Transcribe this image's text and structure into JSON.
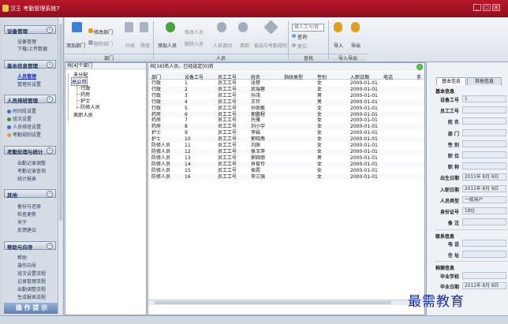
{
  "window": {
    "title": "汉王 考勤管理系统7",
    "min": "_",
    "max": "□",
    "close": "x"
  },
  "sidebar": {
    "groups": [
      {
        "label": "设备管理",
        "toggle": "«",
        "items": [
          "设备管理",
          "下载/上传数据"
        ]
      },
      {
        "label": "基本信息管理",
        "toggle": "«",
        "items": [
          "人员管理",
          "管理员设置"
        ]
      },
      {
        "label": "人员排班管理",
        "toggle": "«",
        "items": [
          "时间段设置",
          "班次设置",
          "人员排班设置",
          "考勤规则设置"
        ]
      },
      {
        "label": "考勤处理与统计",
        "toggle": "«",
        "items": [
          "出勤记录调整",
          "考勤记录查询",
          "统计报表"
        ]
      },
      {
        "label": "其他",
        "toggle": "«",
        "items": [
          "备份与还原",
          "检查更新",
          "关于",
          "反馈建议"
        ]
      },
      {
        "label": "帮助与向导",
        "toggle": "«",
        "items": [
          "帮助",
          "操作向导",
          "班次设置流程",
          "记录管理流程",
          "出勤调整流程",
          "生成报表流程"
        ]
      }
    ],
    "selected": "人员管理",
    "ops_tip": "操 作 提 示",
    "dot_colors": [
      "#3a6fd0",
      "#2e9a3c",
      "#3a6fd0",
      "#e0a020"
    ]
  },
  "ribbon": {
    "dept_buttons": {
      "add": "添加部门",
      "modify": "修改部门",
      "delete": "删除部门",
      "up": "升级",
      "down": "降级"
    },
    "person_buttons": {
      "add": "添加人员",
      "modify": "修改人员",
      "delete": "删除人员",
      "transfer": "人员调动",
      "leave": "离职",
      "batch": "被选与考勤规则"
    },
    "search": {
      "placeholder": "输入工号/姓",
      "query": "查询",
      "clear": "复位"
    },
    "io_buttons": {
      "import": "导入",
      "export": "导出"
    },
    "groups": {
      "dept": "部门",
      "person": "人员",
      "search": "查找",
      "io": "导入导出"
    }
  },
  "tree": {
    "title": "共[4]个部门",
    "nodes": [
      "未分配",
      "总公司",
      "行政",
      "药房",
      "护士",
      "防修人员",
      "离职人员"
    ]
  },
  "grid": {
    "info": "共[16]名人员，已经选定[0]名",
    "columns": [
      "部门",
      "设备工号",
      "员工工号",
      "姓名",
      "指纹类型",
      "性别",
      "入职日期",
      "电话",
      "手"
    ],
    "rows": [
      [
        "行政",
        "1",
        "员工工号",
        "张楚",
        "",
        "女",
        "2000-01-01"
      ],
      [
        "行政",
        "2",
        "员工工号",
        "武瑞蓉",
        "",
        "女",
        "2000-01-01"
      ],
      [
        "行政",
        "3",
        "员工工号",
        "孙茂",
        "",
        "男",
        "2000-01-01"
      ],
      [
        "行政",
        "4",
        "员工工号",
        "王玲",
        "",
        "男",
        "2000-01-01"
      ],
      [
        "行政",
        "5",
        "员工工号",
        "孙凯敏",
        "",
        "女",
        "2000-01-01"
      ],
      [
        "药房",
        "6",
        "员工工号",
        "郭鹏程",
        "",
        "女",
        "2000-01-01"
      ],
      [
        "药房",
        "7",
        "员工工号",
        "托雅",
        "",
        "女",
        "2000-01-01"
      ],
      [
        "药房",
        "8",
        "员工工号",
        "刘小宇",
        "",
        "女",
        "2000-01-01"
      ],
      [
        "护士",
        "9",
        "员工工号",
        "李娟",
        "",
        "女",
        "2000-01-01"
      ],
      [
        "护士",
        "10",
        "员工工号",
        "郭晓燕",
        "",
        "女",
        "2000-01-01"
      ],
      [
        "防修人员",
        "11",
        "员工工号",
        "刘辰",
        "",
        "女",
        "2000-01-01"
      ],
      [
        "防修人员",
        "12",
        "员工工号",
        "侯玉萍",
        "",
        "女",
        "2000-01-01"
      ],
      [
        "防修人员",
        "13",
        "员工工号",
        "郭婉丽",
        "",
        "男",
        "2000-01-01"
      ],
      [
        "防修人员",
        "14",
        "员工工号",
        "肖俊玲",
        "",
        "女",
        "2000-01-01"
      ],
      [
        "防修人员",
        "15",
        "员工工号",
        "侯霞",
        "",
        "女",
        "2000-01-01"
      ],
      [
        "防修人员",
        "16",
        "员工工号",
        "李三强",
        "",
        "女",
        "2000-01-01"
      ]
    ]
  },
  "detail": {
    "tabs": [
      "基本信息",
      "其他信息"
    ],
    "basic_header": "基本信息",
    "fields": [
      {
        "label": "设备工号",
        "value": "1"
      },
      {
        "label": "员工工号",
        "value": ""
      },
      {
        "label": "姓  名",
        "value": ""
      },
      {
        "label": "部  门",
        "value": ""
      },
      {
        "label": "性  别",
        "value": ""
      },
      {
        "label": "职  位",
        "value": ""
      },
      {
        "label": "职  称",
        "value": ""
      },
      {
        "label": "出生日期",
        "value": "2011年 8月 9日"
      },
      {
        "label": "入职日期",
        "value": "2011年 8月 9日"
      },
      {
        "label": "人员类型",
        "value": "一般用户"
      },
      {
        "label": "身份证号",
        "value": "18位"
      },
      {
        "label": "备  注",
        "value": ""
      }
    ],
    "contact_header": "联系信息",
    "contact_fields": [
      {
        "label": "电  话",
        "value": ""
      },
      {
        "label": "住  址",
        "value": ""
      }
    ],
    "archive_header": "档案信息",
    "archive_fields": [
      {
        "label": "毕业学校",
        "value": ""
      },
      {
        "label": "毕业日期",
        "value": "2011年 8月 9日"
      }
    ]
  },
  "watermark": "最需教育"
}
